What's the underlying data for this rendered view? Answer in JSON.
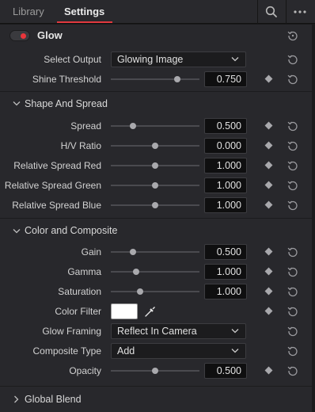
{
  "tabs": {
    "library": "Library",
    "settings": "Settings"
  },
  "toolbar": {
    "search_icon": "search-icon",
    "more_icon": "more-options-icon"
  },
  "effect": {
    "name": "Glow",
    "enabled": true,
    "accent": "#e8353b"
  },
  "fields": {
    "select_output": {
      "label": "Select Output",
      "value": "Glowing Image"
    },
    "shine_threshold": {
      "label": "Shine Threshold",
      "value": "0.750",
      "level": 0.75
    }
  },
  "sections": {
    "shape_spread": "Shape And Spread",
    "color_composite": "Color and Composite",
    "global_blend": "Global Blend"
  },
  "shape": [
    {
      "label": "Spread",
      "value": "0.500",
      "level": 0.25
    },
    {
      "label": "H/V Ratio",
      "value": "0.000",
      "level": 0.5
    },
    {
      "label": "Relative Spread Red",
      "value": "1.000",
      "level": 0.5
    },
    {
      "label": "Relative Spread Green",
      "value": "1.000",
      "level": 0.5
    },
    {
      "label": "Relative Spread Blue",
      "value": "1.000",
      "level": 0.5
    }
  ],
  "color": [
    {
      "label": "Gain",
      "value": "0.500",
      "level": 0.25
    },
    {
      "label": "Gamma",
      "value": "1.000",
      "level": 0.29
    },
    {
      "label": "Saturation",
      "value": "1.000",
      "level": 0.33
    }
  ],
  "color_filter": {
    "label": "Color Filter",
    "color": "#ffffff"
  },
  "glow_framing": {
    "label": "Glow Framing",
    "value": "Reflect In Camera"
  },
  "composite_type": {
    "label": "Composite Type",
    "value": "Add"
  },
  "opacity": {
    "label": "Opacity",
    "value": "0.500",
    "level": 0.5
  }
}
